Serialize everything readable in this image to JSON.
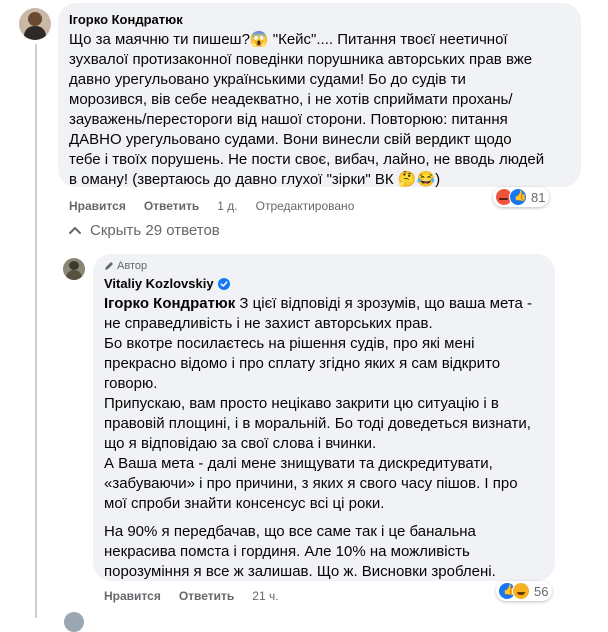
{
  "comment1": {
    "author": "Ігорко Кондратюк",
    "lines": [
      "Що за маячню ти пишеш?😱 \"Кейс\".... Питання твоєї неетичної",
      "зухвалої протизаконної поведінки порушника авторських прав вже",
      "давно урегульовано українськими судами! Бо до судів ти",
      "морозився, вів себе неадекватно, і не хотів сприймати прохань/",
      "зауважень/перестороги від нашої сторони. Повторюю: питання",
      "ДАВНО урегульовано судами. Вони винесли свій вердикт щодо",
      "тебе і твоїх порушень. Не пости своє, вибач, лайно, не вводь людей",
      "в оману! (звертаюсь до давно глухої \"зірки\" ВК 🤔😂)"
    ],
    "like": "Нравится",
    "reply": "Ответить",
    "time": "1 д.",
    "edited": "Отредактировано",
    "reactions_count": "81"
  },
  "replies_toggle": {
    "label": "Скрыть 29 ответов"
  },
  "comment2": {
    "badge": "Автор",
    "author": "Vitaliy Kozlovskiy",
    "mention": "Ігорко Кондратюк",
    "first_line_rest": " З цієї відповіді я зрозумів, що ваша мета -",
    "lines": [
      "не справедливість і не захист авторських прав.",
      "Бо вкотре посилаєтесь на рішення судів, про які мені",
      "прекрасно відомо і про сплату згідно яких я сам відкрито",
      "говорю.",
      "Припускаю, вам просто нецікаво закрити цю ситуацію і в",
      "правовій площині, і в моральній. Бо тоді доведеться визнати,",
      "що я відповідаю за свої слова і вчинки.",
      "А Ваша мета - далі мене знищувати та дискредитувати,",
      "«забуваючи» і про причини, з яких я свого часу пішов. І про",
      "мої спроби знайти консенсус всі ці роки."
    ],
    "para2": [
      "На 90% я передбачав, що все саме так і це банальна",
      "некрасива помста і гординя. Але 10% на можливість",
      "порозуміння я все ж залишав. Що ж. Висновки зроблені."
    ],
    "like": "Нравится",
    "reply": "Ответить",
    "time": "21 ч.",
    "reactions_count": "56"
  },
  "colors": {
    "bubble": "#f0f2f5",
    "meta": "#65676b",
    "verified": "#1877f2",
    "like_blue": "#1877f2",
    "angry": "#f0543c",
    "haha": "#f7b125"
  }
}
